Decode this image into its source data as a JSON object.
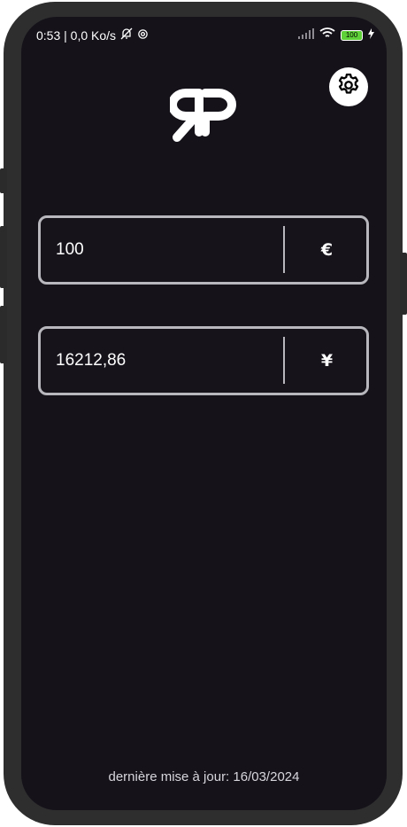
{
  "status_bar": {
    "time_speed": "0:53 | 0,0 Ko/s",
    "battery": "100"
  },
  "converter": {
    "from": {
      "amount": "100",
      "currency": "€"
    },
    "to": {
      "amount": "16212,86",
      "currency": "¥"
    }
  },
  "footer": {
    "last_update": "dernière mise à jour: 16/03/2024"
  }
}
